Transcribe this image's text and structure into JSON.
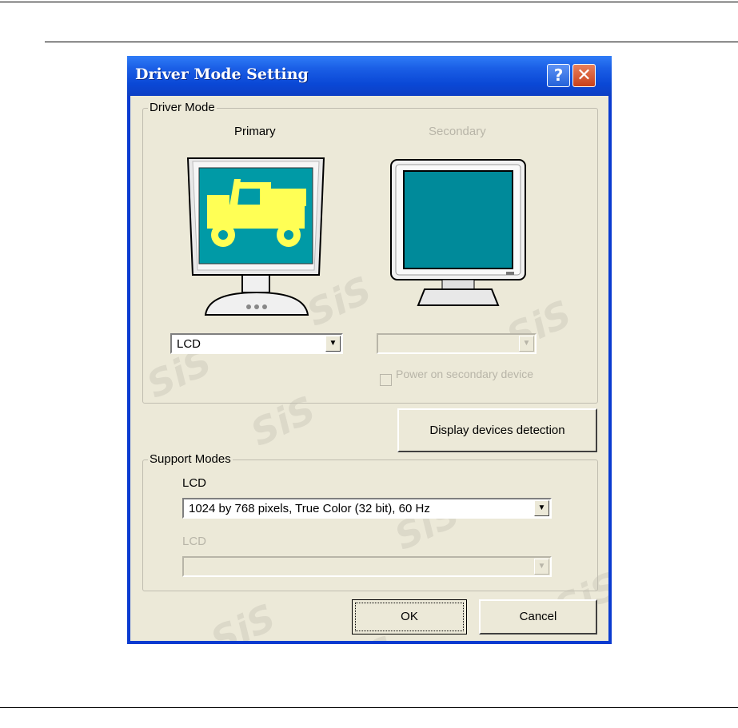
{
  "dialog": {
    "title": "Driver Mode Setting",
    "help_symbol": "?",
    "close_symbol": "✕"
  },
  "driver_mode": {
    "group_label": "Driver Mode",
    "primary": {
      "label": "Primary",
      "selected": "LCD"
    },
    "secondary": {
      "label": "Secondary",
      "selected": ""
    },
    "power_secondary_label": "Power on secondary device"
  },
  "detect_button_label": "Display devices detection",
  "support_modes": {
    "group_label": "Support Modes",
    "primary_label": "LCD",
    "primary_mode": "1024 by 768 pixels, True Color (32 bit), 60 Hz",
    "secondary_label": "LCD",
    "secondary_mode": ""
  },
  "buttons": {
    "ok": "OK",
    "cancel": "Cancel"
  },
  "watermark": "SiS",
  "colors": {
    "title_blue": "#0a48d6",
    "screen_teal": "#009aa6",
    "jeep_yellow": "#ffff55",
    "dialog_bg": "#ece9d8"
  }
}
